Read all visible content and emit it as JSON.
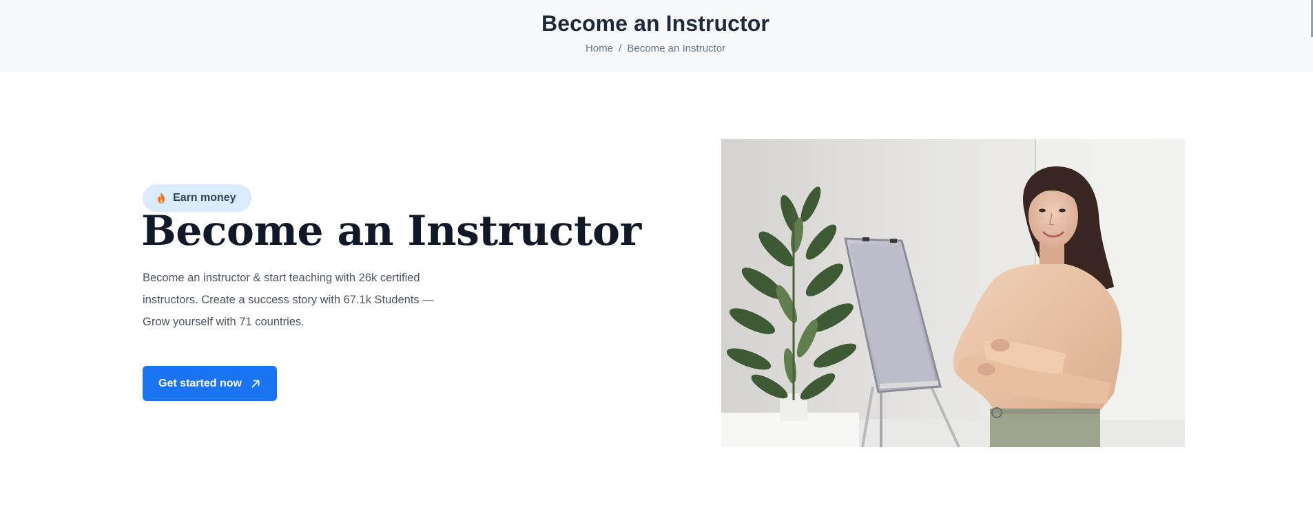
{
  "page_header": {
    "title": "Become an Instructor",
    "breadcrumb": {
      "home": "Home",
      "separator": "/",
      "current": "Become an Instructor"
    }
  },
  "hero": {
    "badge": {
      "icon": "flame-icon",
      "label": "Earn money"
    },
    "title": "Become an Instructor",
    "description": "Become an instructor & start teaching with 26k certified instructors. Create a success story with 67.1k Students — Grow yourself with 71 countries.",
    "cta": {
      "label": "Get started now",
      "icon": "arrow-up-right-icon"
    },
    "image": {
      "subject": "woman with crossed arms next to a flipchart and potted plant"
    }
  },
  "colors": {
    "header_bg": "#f8f9fb",
    "primary": "#1a73f3",
    "badge_bg": "#dbeafe",
    "heading": "#111827",
    "body_text": "#4b5563"
  }
}
